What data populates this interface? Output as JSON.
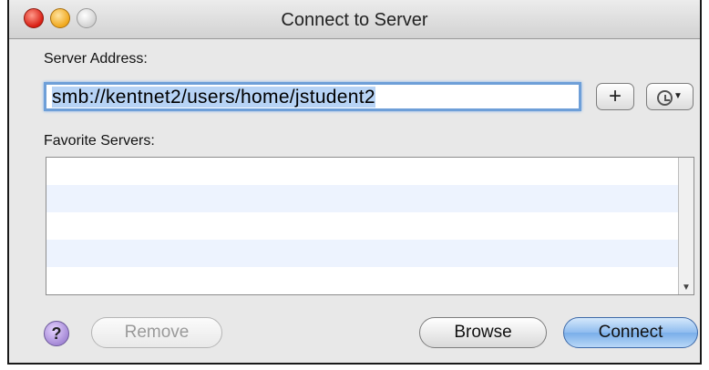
{
  "window": {
    "title": "Connect to Server"
  },
  "server_address": {
    "label": "Server Address:",
    "value": "smb://kentnet2/users/home/jstudent2"
  },
  "buttons": {
    "add": "+",
    "remove": "Remove",
    "browse": "Browse",
    "connect": "Connect",
    "help": "?"
  },
  "favorites": {
    "label": "Favorite Servers:",
    "items": []
  },
  "icons": {
    "close": "close-icon",
    "minimize": "minimize-icon",
    "zoom": "zoom-icon",
    "recent": "clock-icon",
    "help": "help-icon"
  },
  "colors": {
    "focus_ring": "#6e9fd8",
    "selection": "#b7d3f5",
    "connect_button": "#8fbcef",
    "list_alt_row": "#edf3fe"
  }
}
